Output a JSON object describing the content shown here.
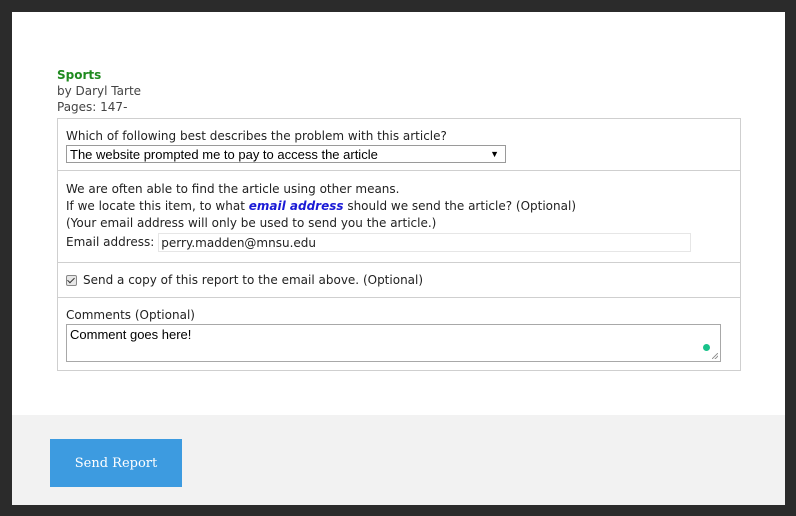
{
  "article": {
    "title": "Sports",
    "author": "by Daryl Tarte",
    "pages": "Pages: 147-"
  },
  "problem": {
    "question": "Which of following best describes the problem with this article?",
    "selected": "The website prompted me to pay to access the article"
  },
  "email": {
    "line1": "We are often able to find the article using other means.",
    "line2_prefix": "If we locate this item, to what ",
    "line2_link": "email address",
    "line2_suffix": " should we send the article? (Optional)",
    "line3": "(Your email address will only be used to send you the article.)",
    "label": "Email address:",
    "value": "perry.madden@mnsu.edu"
  },
  "copy": {
    "label": "Send a copy of this report to the email above. (Optional)",
    "checked": true
  },
  "comments": {
    "label": "Comments (Optional)",
    "value": "Comment goes here!"
  },
  "footer": {
    "send_label": "Send Report"
  },
  "colors": {
    "accent": "#3d9be0",
    "title_green": "#1f8a1f",
    "link_blue": "#1a1ad6",
    "status_dot": "#19c28a"
  }
}
